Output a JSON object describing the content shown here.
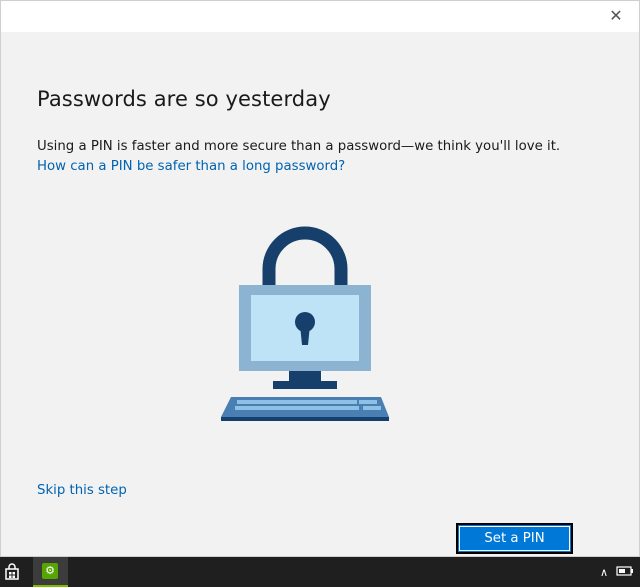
{
  "window": {
    "close_symbol": "✕"
  },
  "main": {
    "heading": "Passwords are so yesterday",
    "description": "Using a PIN is faster and more secure than a password—we think you'll love it.",
    "pin_info_link": "How can a PIN be safer than a long password?",
    "skip_link": "Skip this step",
    "set_pin_button": "Set a PIN"
  },
  "illustration": {
    "icon": "lock-computer-icon",
    "colors": {
      "dark": "#16406b",
      "frame": "#8cb4d2",
      "screen": "#bfe3f6",
      "keyboard": "#4a7fb4"
    }
  },
  "taskbar": {
    "icons": [
      "store-icon",
      "settings-icon",
      "chevron-up-icon",
      "battery-icon"
    ]
  },
  "colors": {
    "accent": "#0078d7",
    "link": "#0063b1",
    "background": "#f2f2f2",
    "taskbar": "#1f1f1f"
  }
}
